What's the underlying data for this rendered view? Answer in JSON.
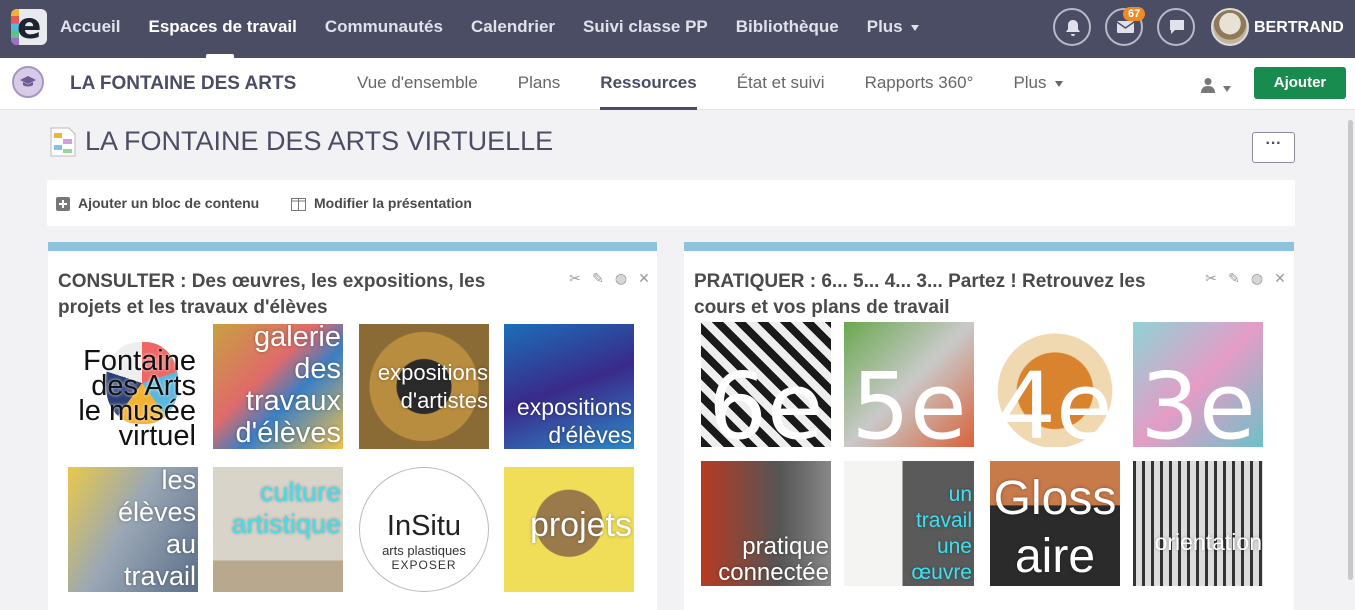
{
  "topbar": {
    "logo_letter": "e",
    "nav": [
      "Accueil",
      "Espaces de travail",
      "Communautés",
      "Calendrier",
      "Suivi classe PP",
      "Bibliothèque",
      "Plus"
    ],
    "active_index": 1,
    "mail_badge": "67",
    "username": "BERTRAND"
  },
  "subbar": {
    "workspace_title": "LA FONTAINE DES ARTS",
    "tabs": [
      "Vue d'ensemble",
      "Plans",
      "Ressources",
      "État et suivi",
      "Rapports 360°",
      "Plus"
    ],
    "active_index": 2,
    "add_button": "Ajouter"
  },
  "page": {
    "title": "LA FONTAINE DES ARTS VIRTUELLE",
    "more_button": "···",
    "toolbar": {
      "add_block": "Ajouter un bloc de contenu",
      "edit_layout": "Modifier la présentation"
    }
  },
  "block_left": {
    "title_line1": "CONSULTER : Des œuvres, les expositions, les",
    "title_line2": "projets et les travaux d'élèves",
    "tiles": [
      {
        "lines": [
          "Fontaine",
          "des Arts",
          "le musée",
          "virtuel"
        ]
      },
      {
        "lines": [
          "galerie",
          "des",
          "travaux",
          "d'élèves"
        ]
      },
      {
        "lines": [
          "expositions",
          "d'artistes"
        ]
      },
      {
        "lines": [
          "expositions",
          "d'élèves"
        ]
      },
      {
        "lines": [
          "les",
          "élèves",
          "au",
          "travail"
        ]
      },
      {
        "lines": [
          "culture",
          "artistique"
        ]
      },
      {
        "lines": [
          "InSitu",
          "arts plastiques",
          "EXPOSER"
        ]
      },
      {
        "lines": [
          "projets"
        ]
      }
    ]
  },
  "block_right": {
    "title_line1": "PRATIQUER : 6... 5... 4... 3... Partez ! Retrouvez les",
    "title_line2": "cours et vos plans de travail",
    "tiles": [
      {
        "lines": [
          "6e"
        ]
      },
      {
        "lines": [
          "5e"
        ]
      },
      {
        "lines": [
          "4e"
        ]
      },
      {
        "lines": [
          "3e"
        ]
      },
      {
        "lines": [
          "pratique",
          "connectée"
        ]
      },
      {
        "lines": [
          "un",
          "travail",
          "une",
          "œuvre"
        ]
      },
      {
        "lines": [
          "Gloss",
          "aire"
        ]
      },
      {
        "lines": [
          "orientation"
        ]
      }
    ]
  }
}
